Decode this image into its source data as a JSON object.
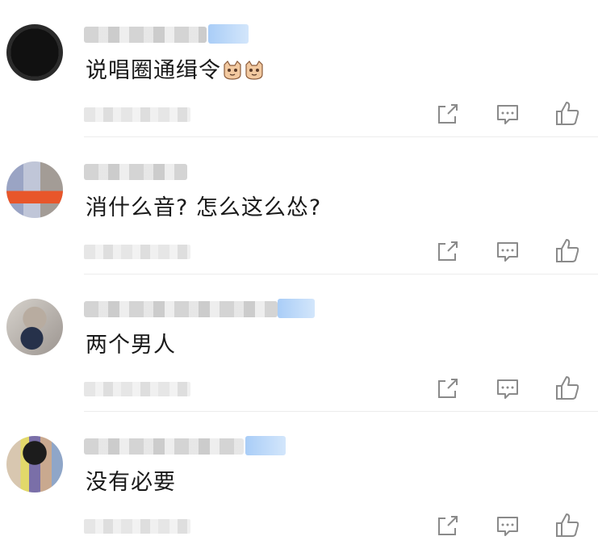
{
  "comments": [
    {
      "text": "说唱圈通缉令",
      "emoji_count": 2,
      "vip_badge": true,
      "avatar_style": "dark"
    },
    {
      "text": "消什么音? 怎么这么怂?",
      "emoji_count": 0,
      "vip_badge": false,
      "avatar_style": "colorful"
    },
    {
      "text": "两个男人",
      "emoji_count": 0,
      "vip_badge": true,
      "avatar_style": "gray"
    },
    {
      "text": "没有必要",
      "emoji_count": 0,
      "vip_badge": true,
      "avatar_style": "colorful2"
    }
  ],
  "icons": {
    "share": "share-icon",
    "reply": "comment-icon",
    "like": "thumbs-up-icon",
    "emoji": "cat-face-emoji"
  },
  "colors": {
    "text": "#1a1a1a",
    "icon": "#8a8a8a",
    "vip_badge": "#a9cdf7",
    "divider": "#ececec"
  }
}
